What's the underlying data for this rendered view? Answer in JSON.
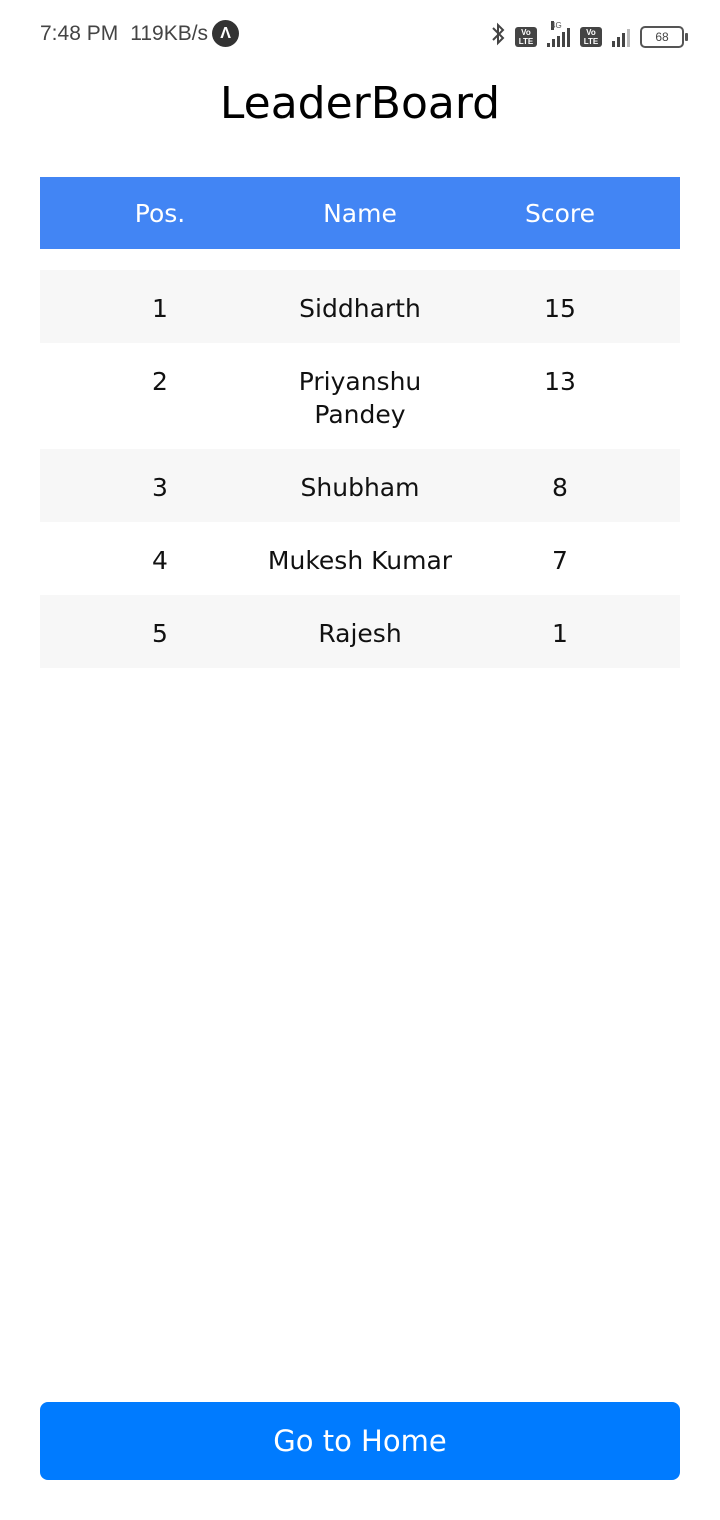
{
  "status_bar": {
    "time": "7:48 PM",
    "speed": "119KB/s",
    "app_icon": "Λ",
    "bluetooth_icon": "bluetooth-icon",
    "volte1": "Vo LTE",
    "network_type": "4G",
    "volte2": "Vo LTE",
    "battery": "68"
  },
  "page": {
    "title": "LeaderBoard"
  },
  "table": {
    "header": {
      "pos": "Pos.",
      "name": "Name",
      "score": "Score"
    },
    "header_color": "#4285f4",
    "rows": [
      {
        "pos": "1",
        "name": "Siddharth",
        "score": "15"
      },
      {
        "pos": "2",
        "name": "Priyanshu Pandey",
        "score": "13"
      },
      {
        "pos": "3",
        "name": "Shubham",
        "score": "8"
      },
      {
        "pos": "4",
        "name": "Mukesh Kumar",
        "score": "7"
      },
      {
        "pos": "5",
        "name": "Rajesh",
        "score": "1"
      }
    ]
  },
  "home_button": {
    "label": "Go to Home",
    "color": "#007bff"
  }
}
